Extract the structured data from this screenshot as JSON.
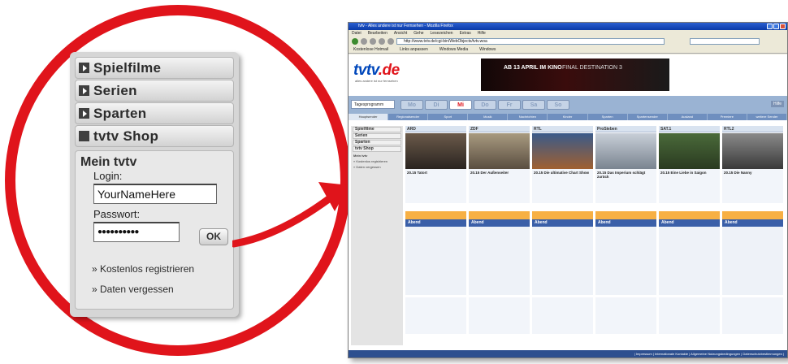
{
  "callout": {
    "menu": [
      {
        "label": "Spielfilme"
      },
      {
        "label": "Serien"
      },
      {
        "label": "Sparten"
      },
      {
        "label": "tvtv Shop"
      }
    ],
    "mein_title": "Mein tvtv",
    "login_label": "Login:",
    "login_value": "YourNameHere",
    "password_label": "Passwort:",
    "password_value": "●●●●●●●●●●",
    "ok_label": "OK",
    "links": [
      "» Kostenlos registrieren",
      "» Daten vergessen"
    ]
  },
  "colors": {
    "accent_red": "#e0141b",
    "brand_blue": "#0047bb",
    "nav_blue": "#9ab3d3"
  },
  "browser": {
    "title": "tvtv - Alles andere ist nur Fernsehen - Mozilla Firefox",
    "menu": [
      "Datei",
      "Bearbeiten",
      "Ansicht",
      "Gehe",
      "Lesezeichen",
      "Extras",
      "Hilfe"
    ],
    "address": "http://www.tvtv.de/cgi-bin/WebObjects/tvtv.woa",
    "bookmarks": [
      "Kostenlose Hotmail",
      "Links anpassen",
      "Windows Media",
      "Windows"
    ],
    "logo_main": "tvtv",
    "logo_dot": ".de",
    "slogan": "alles andere ist nur fernsehen",
    "banner": {
      "line1": "AB 13 APRIL IM KINO",
      "line2": "FINAL DESTINATION 3"
    },
    "tagesprogramm": "Tagesprogramm",
    "days": [
      {
        "label": "Mo",
        "active": false
      },
      {
        "label": "Di",
        "active": false
      },
      {
        "label": "Mi",
        "active": true
      },
      {
        "label": "Do",
        "active": false
      },
      {
        "label": "Fr",
        "active": false
      },
      {
        "label": "Sa",
        "active": false
      },
      {
        "label": "So",
        "active": false
      }
    ],
    "help": "Hilfe",
    "subnav": [
      "Hauptsender",
      "Regionalsender",
      "Sport",
      "Musik",
      "Nachrichten",
      "Kinder",
      "Sparten",
      "Spartensender",
      "Ausland",
      "Premiere",
      "weitere Sender"
    ],
    "sidebar": [
      "Spielfilme",
      "Serien",
      "Sparten",
      "tvtv Shop",
      "Mein tvtv"
    ],
    "sidebar_links": [
      "» Kostenlos registrieren",
      "» Daten vergessen"
    ],
    "channels": [
      {
        "name": "ARD",
        "top": "20.15 Tatort",
        "abend": "Abend"
      },
      {
        "name": "ZDF",
        "top": "20.15 Der Außenseiter",
        "abend": "Abend"
      },
      {
        "name": "RTL",
        "top": "20.15 Die ultimative Chart Show",
        "abend": "Abend"
      },
      {
        "name": "ProSieben",
        "top": "20.15 Das Imperium schlägt zurück",
        "abend": "Abend"
      },
      {
        "name": "SAT.1",
        "top": "20.15 Eine Liebe in Saigon",
        "abend": "Abend"
      },
      {
        "name": "RTL2",
        "top": "20.15 Die Nanny",
        "abend": "Abend"
      }
    ],
    "footer": "| Impressum | Internationale Kontakte | Allgemeine Nutzungsbedingungen | Datenschutzbestimmungen |"
  }
}
